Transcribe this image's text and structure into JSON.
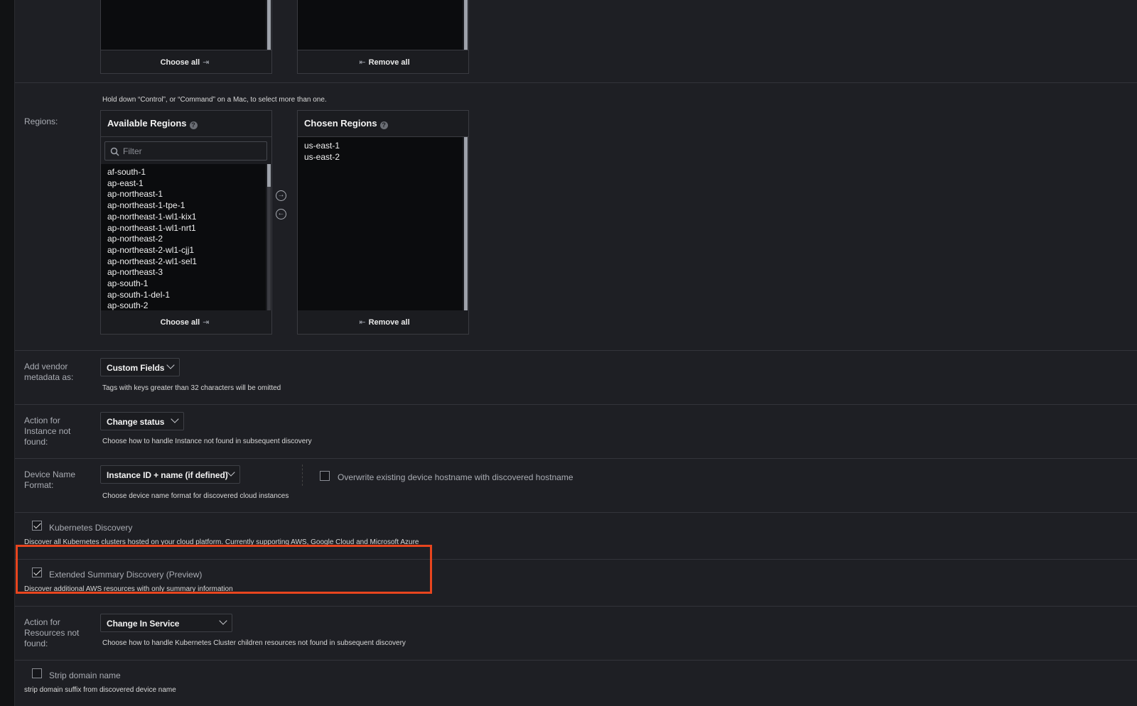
{
  "services_box": {
    "choose_all": "Choose all",
    "remove_all": "Remove all"
  },
  "regions": {
    "label": "Regions:",
    "hint": "Hold down “Control”, or “Command” on a Mac, to select more than one.",
    "available_title": "Available Regions",
    "chosen_title": "Chosen Regions",
    "filter_placeholder": "Filter",
    "available": [
      "af-south-1",
      "ap-east-1",
      "ap-northeast-1",
      "ap-northeast-1-tpe-1",
      "ap-northeast-1-wl1-kix1",
      "ap-northeast-1-wl1-nrt1",
      "ap-northeast-2",
      "ap-northeast-2-wl1-cjj1",
      "ap-northeast-2-wl1-sel1",
      "ap-northeast-3",
      "ap-south-1",
      "ap-south-1-del-1",
      "ap-south-2"
    ],
    "chosen": [
      "us-east-1",
      "us-east-2"
    ],
    "choose_all": "Choose all",
    "remove_all": "Remove all",
    "icons": {
      "choose": "arrow-right-circle-icon",
      "remove": "arrow-left-circle-icon",
      "help": "question-circle-icon"
    }
  },
  "vendor_metadata": {
    "label": "Add vendor metadata as:",
    "value": "Custom Fields",
    "help": "Tags with keys greater than 32 characters will be omitted"
  },
  "instance_not_found": {
    "label": "Action for Instance not found:",
    "value": "Change status",
    "help": "Choose how to handle Instance not found in subsequent discovery"
  },
  "device_name_format": {
    "label": "Device Name Format:",
    "value": "Instance ID + name (if defined)",
    "help": "Choose device name format for discovered cloud instances",
    "overwrite_label": "Overwrite existing device hostname with discovered hostname",
    "overwrite_checked": false
  },
  "kubernetes": {
    "label": "Kubernetes Discovery",
    "checked": true,
    "help": "Discover all Kubernetes clusters hosted on your cloud platform. Currently supporting AWS, Google Cloud and Microsoft Azure"
  },
  "extended_summary": {
    "label": "Extended Summary Discovery (Preview)",
    "checked": true,
    "help": "Discover additional AWS resources with only summary information"
  },
  "resources_not_found": {
    "label": "Action for Resources not found:",
    "value": "Change In Service",
    "help": "Choose how to handle Kubernetes Cluster children resources not found in subsequent discovery"
  },
  "strip_domain": {
    "label": "Strip domain name",
    "checked": false,
    "help": "strip domain suffix from discovered device name"
  },
  "colors": {
    "highlight": "#e8451e",
    "background": "#1e1f24"
  }
}
